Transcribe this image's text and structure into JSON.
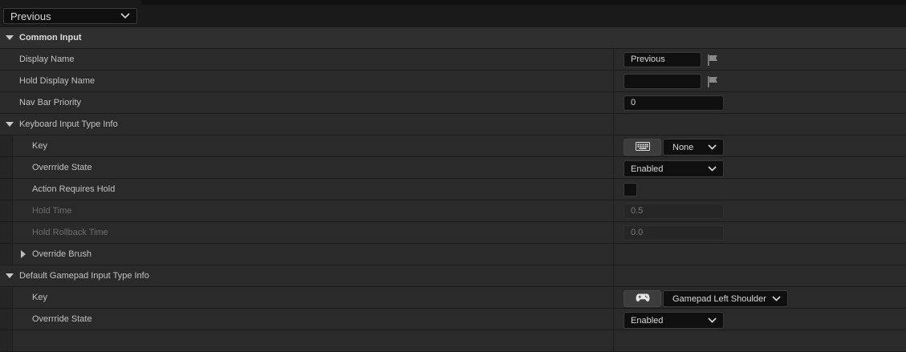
{
  "header": {
    "asset_select": "Previous"
  },
  "rows": {
    "common_input": {
      "label": "Common Input"
    },
    "display_name": {
      "label": "Display Name",
      "value": "Previous"
    },
    "hold_display_name": {
      "label": "Hold Display Name",
      "value": ""
    },
    "nav_bar_priority": {
      "label": "Nav Bar Priority",
      "value": "0"
    },
    "keyboard": {
      "label": "Keyboard Input Type Info"
    },
    "kb_key": {
      "label": "Key",
      "value": "None"
    },
    "kb_override_state": {
      "label": "Overrride State",
      "value": "Enabled"
    },
    "kb_action_requires_hold": {
      "label": "Action Requires Hold",
      "checked": false
    },
    "kb_hold_time": {
      "label": "Hold Time",
      "value": "0.5"
    },
    "kb_hold_rollback_time": {
      "label": "Hold Rollback Time",
      "value": "0.0"
    },
    "kb_override_brush": {
      "label": "Override Brush"
    },
    "gamepad": {
      "label": "Default Gamepad Input Type Info"
    },
    "gp_key": {
      "label": "Key",
      "value": "Gamepad Left Shoulder"
    },
    "gp_override_state": {
      "label": "Overrride State",
      "value": "Enabled"
    }
  },
  "icons": {
    "flag": "flag-icon",
    "keyboard": "keyboard-icon",
    "gamepad": "gamepad-icon",
    "expand": "triangle-down-icon",
    "collapsed": "triangle-right-icon",
    "dropdown": "chevron-down-icon"
  },
  "colors": {
    "background": "#242424",
    "row": "#2a2a2a",
    "category_row": "#2f2f2f",
    "input_bg": "#0f0f0f",
    "text": "#c2c2c2",
    "disabled_text": "#6e6e6e"
  }
}
